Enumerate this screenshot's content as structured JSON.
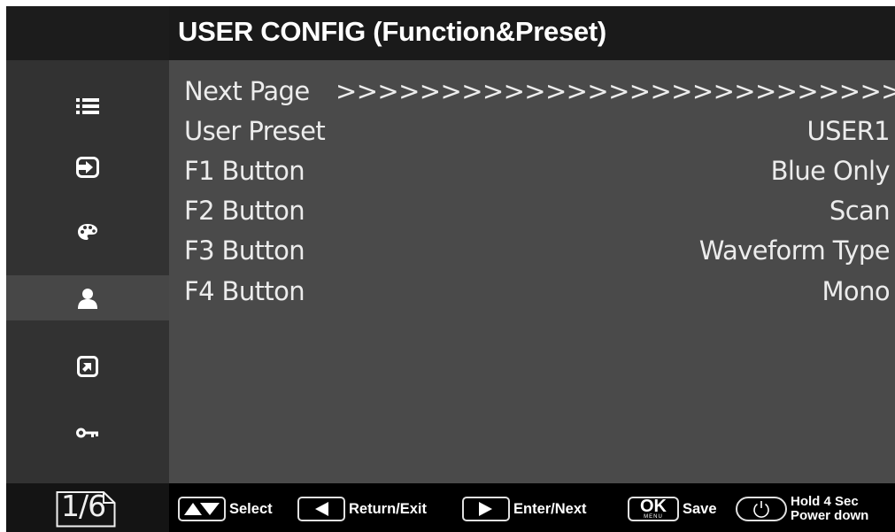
{
  "header": {
    "title": "USER CONFIG (Function&Preset)"
  },
  "sidebar": {
    "items": [
      {
        "name": "list-icon",
        "active": false
      },
      {
        "name": "input-icon",
        "active": false
      },
      {
        "name": "palette-icon",
        "active": false
      },
      {
        "name": "user-icon",
        "active": true
      },
      {
        "name": "external-link-icon",
        "active": false
      },
      {
        "name": "key-icon",
        "active": false
      }
    ],
    "page_indicator": "1/6"
  },
  "menu": {
    "rows": [
      {
        "label": "Next Page",
        "value": ">>>>>>>>>>>>>>>>>>>>>>>>>>>"
      },
      {
        "label": "User Preset",
        "value": "USER1"
      },
      {
        "label": "F1 Button",
        "value": "Blue Only"
      },
      {
        "label": "F2 Button",
        "value": "Scan"
      },
      {
        "label": "F3 Button",
        "value": "Waveform Type"
      },
      {
        "label": "F4 Button",
        "value": "Mono"
      }
    ]
  },
  "footer": {
    "hints": [
      {
        "key": "up-down-icon",
        "label": "Select"
      },
      {
        "key": "left-arrow-icon",
        "label": "Return/Exit"
      },
      {
        "key": "right-arrow-icon",
        "label": "Enter/Next"
      },
      {
        "key": "ok-menu-icon",
        "key_text": "OK",
        "key_subtext": "MENU",
        "label": "Save"
      },
      {
        "key": "power-icon",
        "label_line1": "Hold 4 Sec",
        "label_line2": "Power down"
      }
    ]
  },
  "colors": {
    "content_bg": "#4a4a4a",
    "sidebar_bg": "#323232",
    "active_bg": "#474747",
    "title_bg": "#1a1a1a",
    "text": "#ececec"
  }
}
